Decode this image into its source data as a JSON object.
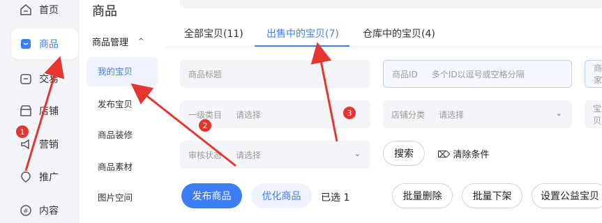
{
  "rail": {
    "items": [
      {
        "label": "首页",
        "icon": "home-icon"
      },
      {
        "label": "商品",
        "icon": "goods-icon",
        "active": true
      },
      {
        "label": "交易",
        "icon": "trade-icon"
      },
      {
        "label": "店铺",
        "icon": "shop-icon"
      },
      {
        "label": "营销",
        "icon": "marketing-icon"
      },
      {
        "label": "推广",
        "icon": "promote-icon"
      },
      {
        "label": "内容",
        "icon": "content-icon"
      }
    ]
  },
  "subnav": {
    "title": "商品",
    "group": "商品管理",
    "items": [
      "我的宝贝",
      "发布宝贝",
      "商品装修",
      "商品素材",
      "图片空间"
    ]
  },
  "tabs": [
    "全部宝贝(11)",
    "出售中的宝贝(7)",
    "仓库中的宝贝(4)"
  ],
  "filters": {
    "title_placeholder": "商品标题",
    "id_label": "商品ID",
    "id_placeholder": "多个ID以逗号或空格分隔",
    "next_label": "商家",
    "category_label": "一级类目",
    "category_value": "请选择",
    "shop_category_label": "店铺分类",
    "shop_category_value": "请选择",
    "baby_label": "宝贝",
    "audit_label": "审核状态",
    "audit_value": "请选择"
  },
  "actions": {
    "search": "搜索",
    "clear": "清除条件",
    "publish": "发布商品",
    "optimize": "优化商品",
    "selected": "已选 1",
    "batch_delete": "批量删除",
    "batch_delist": "批量下架",
    "charity": "设置公益宝贝"
  },
  "annotations": [
    "1",
    "2",
    "3"
  ],
  "colors": {
    "accent": "#3d7ef6",
    "annotation": "#e8342f"
  }
}
